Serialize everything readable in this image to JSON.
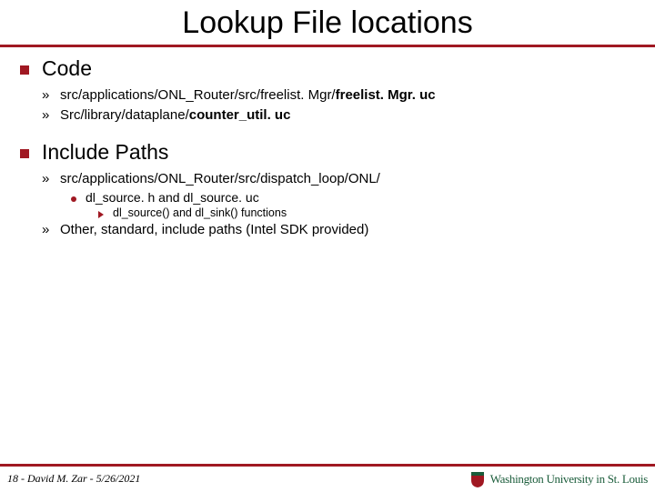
{
  "title": "Lookup File locations",
  "sections": [
    {
      "heading": "Code",
      "items": [
        {
          "prefix": "src/applications/ONL_Router/src/freelist. Mgr/",
          "bold": "freelist. Mgr. uc"
        },
        {
          "prefix": "Src/library/dataplane/",
          "bold": "counter_util. uc"
        }
      ]
    },
    {
      "heading": "Include Paths",
      "items": [
        {
          "prefix": "src/applications/ONL_Router/src/dispatch_loop/ONL/",
          "bold": "",
          "sub": {
            "text_a": "dl_source. h ",
            "text_b": "and ",
            "text_c": "dl_source. uc",
            "subsub": "dl_source() and dl_sink() functions"
          }
        },
        {
          "prefix": "Other, standard, include paths (Intel SDK provided)",
          "bold": ""
        }
      ]
    }
  ],
  "footer": {
    "page": "18",
    "sep": " - ",
    "author": "David M. Zar",
    "date": "5/26/2021",
    "university": "Washington University in St. Louis"
  }
}
